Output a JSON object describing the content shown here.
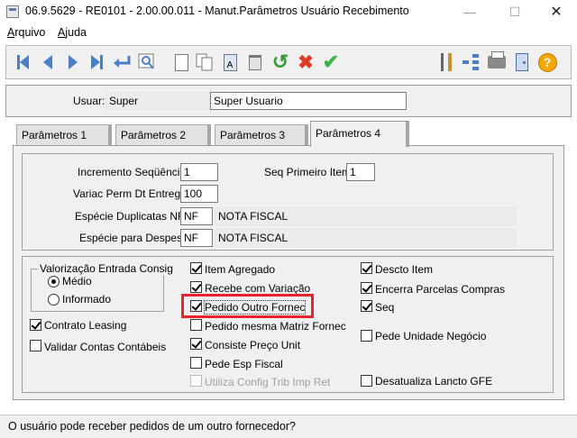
{
  "window": {
    "title": "06.9.5629 - RE0101 - 2.00.00.011 - Manut.Parâmetros Usuário Recebimento",
    "minimize": "—",
    "maximize": "☐",
    "close": "✕"
  },
  "menu": {
    "items": [
      "Arquivo",
      "Ajuda"
    ]
  },
  "toolbar": {
    "icons": [
      "first-icon",
      "previous-icon",
      "next-icon",
      "last-icon",
      "goto-icon",
      "search-icon",
      "new-icon",
      "copy-icon",
      "edit-icon",
      "delete-icon",
      "undo-icon",
      "cancel-icon",
      "save-icon",
      "tools-icon",
      "tree-icon",
      "print-icon",
      "exit-icon",
      "help-icon"
    ],
    "edit_glyph": "A",
    "help_glyph": "?"
  },
  "header": {
    "user_label": "Usuar:",
    "user_code": "Super",
    "user_name": "Super Usuario"
  },
  "tabs": [
    {
      "label": "Parâmetros 1",
      "active": false
    },
    {
      "label": "Parâmetros 2",
      "active": false
    },
    {
      "label": "Parâmetros 3",
      "active": false
    },
    {
      "label": "Parâmetros 4",
      "active": true
    }
  ],
  "fields": {
    "incremento_label": "Incremento Seqüência:",
    "incremento_value": "1",
    "seq_primeiro_label": "Seq Primeiro Item:",
    "seq_primeiro_value": "1",
    "variac_label": "Variac Perm Dt Entrega:",
    "variac_value": "100",
    "especie_dup_label": "Espécie Duplicatas NFF:",
    "especie_dup_code": "NF",
    "especie_dup_desc": "NOTA FISCAL",
    "especie_desp_label": "Espécie para Despesas:",
    "especie_desp_code": "NF",
    "especie_desp_desc": "NOTA FISCAL"
  },
  "valorizacao": {
    "title": "Valorização Entrada Consig",
    "options": [
      {
        "label": "Médio",
        "selected": true
      },
      {
        "label": "Informado",
        "selected": false
      }
    ]
  },
  "left_checks": [
    {
      "label": "Contrato Leasing",
      "checked": true
    },
    {
      "label": "Validar Contas Contábeis",
      "checked": false
    }
  ],
  "mid_checks": [
    {
      "label": "Item Agregado",
      "checked": true,
      "disabled": false
    },
    {
      "label": "Recebe com Variação",
      "checked": true,
      "disabled": false
    },
    {
      "label": "Pedido Outro Fornec",
      "checked": true,
      "disabled": false
    },
    {
      "label": "Pedido mesma Matriz Fornec",
      "checked": false,
      "disabled": false
    },
    {
      "label": "Consiste Preço Unit",
      "checked": true,
      "disabled": false
    },
    {
      "label": "Pede Esp Fiscal",
      "checked": false,
      "disabled": false
    },
    {
      "label": "Utiliza Config Trib Imp Ret",
      "checked": false,
      "disabled": true
    }
  ],
  "right_checks": [
    {
      "label": "Descto Item",
      "checked": true
    },
    {
      "label": "Encerra Parcelas Compras",
      "checked": true
    },
    {
      "label": "Seq",
      "checked": true
    },
    {
      "label": "Pede Unidade Negócio",
      "checked": false
    },
    {
      "label": "Desatualiza Lancto GFE",
      "checked": false
    }
  ],
  "status": {
    "text": "O usuário pode receber pedidos de um outro fornecedor?"
  },
  "colors": {
    "highlight": "#e8232a",
    "nav_blue": "#4a7fc8",
    "cancel_red": "#e03a2a",
    "save_green": "#3db34a"
  }
}
